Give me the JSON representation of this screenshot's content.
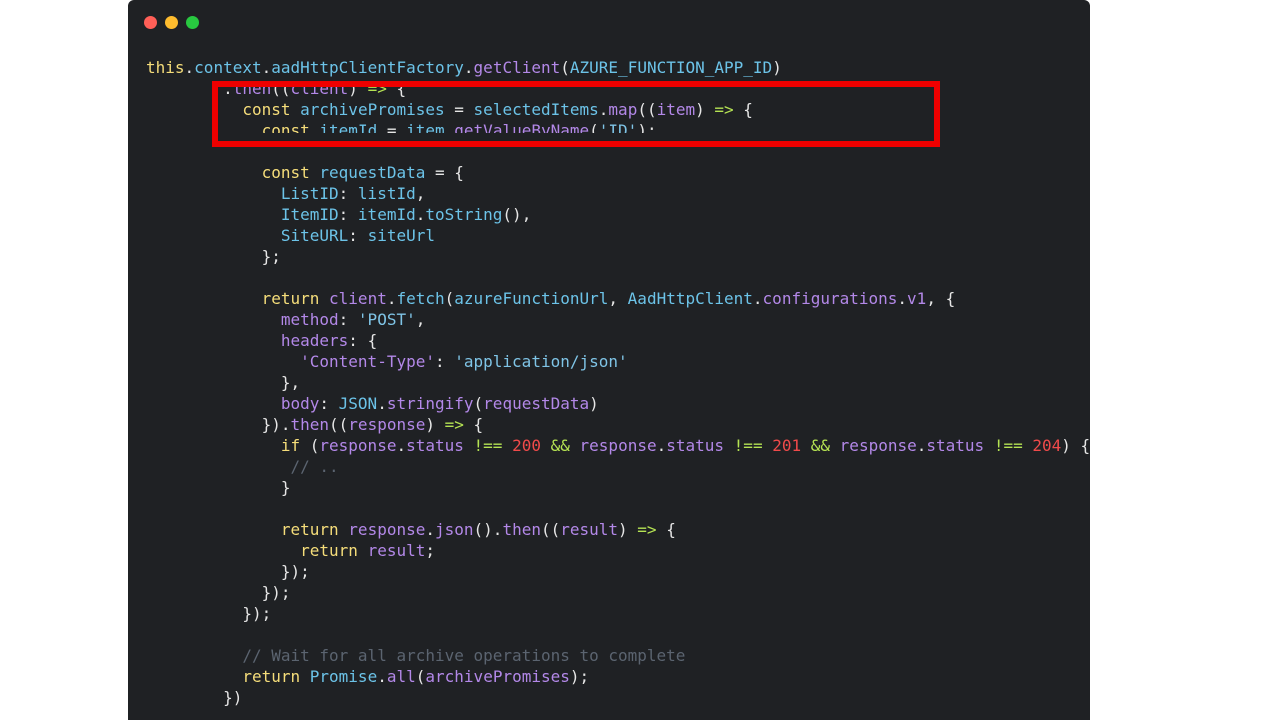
{
  "window": {
    "controls": [
      "close",
      "minimize",
      "maximize"
    ],
    "colors": {
      "close": "#ff5f57",
      "minimize": "#febc2e",
      "maximize": "#28c840",
      "background": "#1f2124"
    }
  },
  "highlight": {
    "color": "#ee0000"
  },
  "code": {
    "l1": {
      "a": "this",
      "b": ".",
      "c": "context",
      "d": ".",
      "e": "aadHttpClientFactory",
      "f": ".",
      "g": "getClient",
      "h": "(",
      "i": "AZURE_FUNCTION_APP_ID",
      "j": ")"
    },
    "l2": {
      "indent": "        ",
      "a": ".",
      "b": "then",
      "c": "((",
      "d": "client",
      "e": ") ",
      "f": "=>",
      "g": " {"
    },
    "l3": {
      "indent": "          ",
      "a": "const",
      "b": " ",
      "c": "archivePromises",
      "d": " = ",
      "e": "selectedItems",
      "f": ".",
      "g": "map",
      "h": "((",
      "i": "item",
      "j": ") ",
      "k": "=>",
      "l": " {"
    },
    "l4": {
      "indent": "            ",
      "a": "const",
      "b": " ",
      "c": "itemId",
      "d": " = ",
      "e": "item",
      "f": ".",
      "g": "getValueByName",
      "h": "(",
      "i": "'ID'",
      "j": ");"
    },
    "l5": {
      "indent": "            ",
      "a": "const",
      "b": " ",
      "c": "requestData",
      "d": " = {"
    },
    "l6": {
      "indent": "              ",
      "a": "ListID",
      "b": ": ",
      "c": "listId",
      "d": ","
    },
    "l7": {
      "indent": "              ",
      "a": "ItemID",
      "b": ": ",
      "c": "itemId",
      "d": ".",
      "e": "toString",
      "f": "(),"
    },
    "l8": {
      "indent": "              ",
      "a": "SiteURL",
      "b": ": ",
      "c": "siteUrl"
    },
    "l9": {
      "indent": "            ",
      "a": "};"
    },
    "l10": {
      "indent": "            ",
      "a": "return",
      "b": " ",
      "c": "client",
      "d": ".",
      "e": "fetch",
      "f": "(",
      "g": "azureFunctionUrl",
      "h": ", ",
      "i": "AadHttpClient",
      "j": ".",
      "k": "configurations",
      "l": ".",
      "m": "v1",
      "n": ", {"
    },
    "l11": {
      "indent": "              ",
      "a": "method",
      "b": ": ",
      "c": "'POST'",
      "d": ","
    },
    "l12": {
      "indent": "              ",
      "a": "headers",
      "b": ": {"
    },
    "l13": {
      "indent": "                ",
      "a": "'Content-Type'",
      "b": ": ",
      "c": "'application/json'"
    },
    "l14": {
      "indent": "              ",
      "a": "},"
    },
    "l15": {
      "indent": "              ",
      "a": "body",
      "b": ": ",
      "c": "JSON",
      "d": ".",
      "e": "stringify",
      "f": "(",
      "g": "requestData",
      "h": ")"
    },
    "l16": {
      "indent": "            ",
      "a": "}).",
      "b": "then",
      "c": "((",
      "d": "response",
      "e": ") ",
      "f": "=>",
      "g": " {"
    },
    "l17": {
      "indent": "              ",
      "a": "if",
      "b": " (",
      "c": "response",
      "d": ".",
      "e": "status",
      "f": " ",
      "g": "!==",
      "h": " ",
      "i": "200",
      "j": " ",
      "k": "&&",
      "l": " ",
      "m": "response",
      "n": ".",
      "o": "status",
      "p": " ",
      "q": "!==",
      "r": " ",
      "s": "201",
      "t": " ",
      "u": "&&",
      "v": " ",
      "w": "response",
      "x": ".",
      "y": "status",
      "z": " ",
      "aa": "!==",
      "ab": " ",
      "ac": "204",
      "ad": ") {"
    },
    "l18": {
      "indent": "               ",
      "a": "// .."
    },
    "l19": {
      "indent": "              ",
      "a": "}"
    },
    "l20": {
      "indent": "              ",
      "a": "return",
      "b": " ",
      "c": "response",
      "d": ".",
      "e": "json",
      "f": "().",
      "g": "then",
      "h": "((",
      "i": "result",
      "j": ") ",
      "k": "=>",
      "l": " {"
    },
    "l21": {
      "indent": "                ",
      "a": "return",
      "b": " ",
      "c": "result",
      "d": ";"
    },
    "l22": {
      "indent": "              ",
      "a": "});"
    },
    "l23": {
      "indent": "            ",
      "a": "});"
    },
    "l24": {
      "indent": "          ",
      "a": "});"
    },
    "l25": {
      "indent": "          ",
      "a": "// Wait for all archive operations to complete"
    },
    "l26": {
      "indent": "          ",
      "a": "return",
      "b": " ",
      "c": "Promise",
      "d": ".",
      "e": "all",
      "f": "(",
      "g": "archivePromises",
      "h": ");"
    },
    "l27": {
      "indent": "        ",
      "a": "})"
    }
  }
}
